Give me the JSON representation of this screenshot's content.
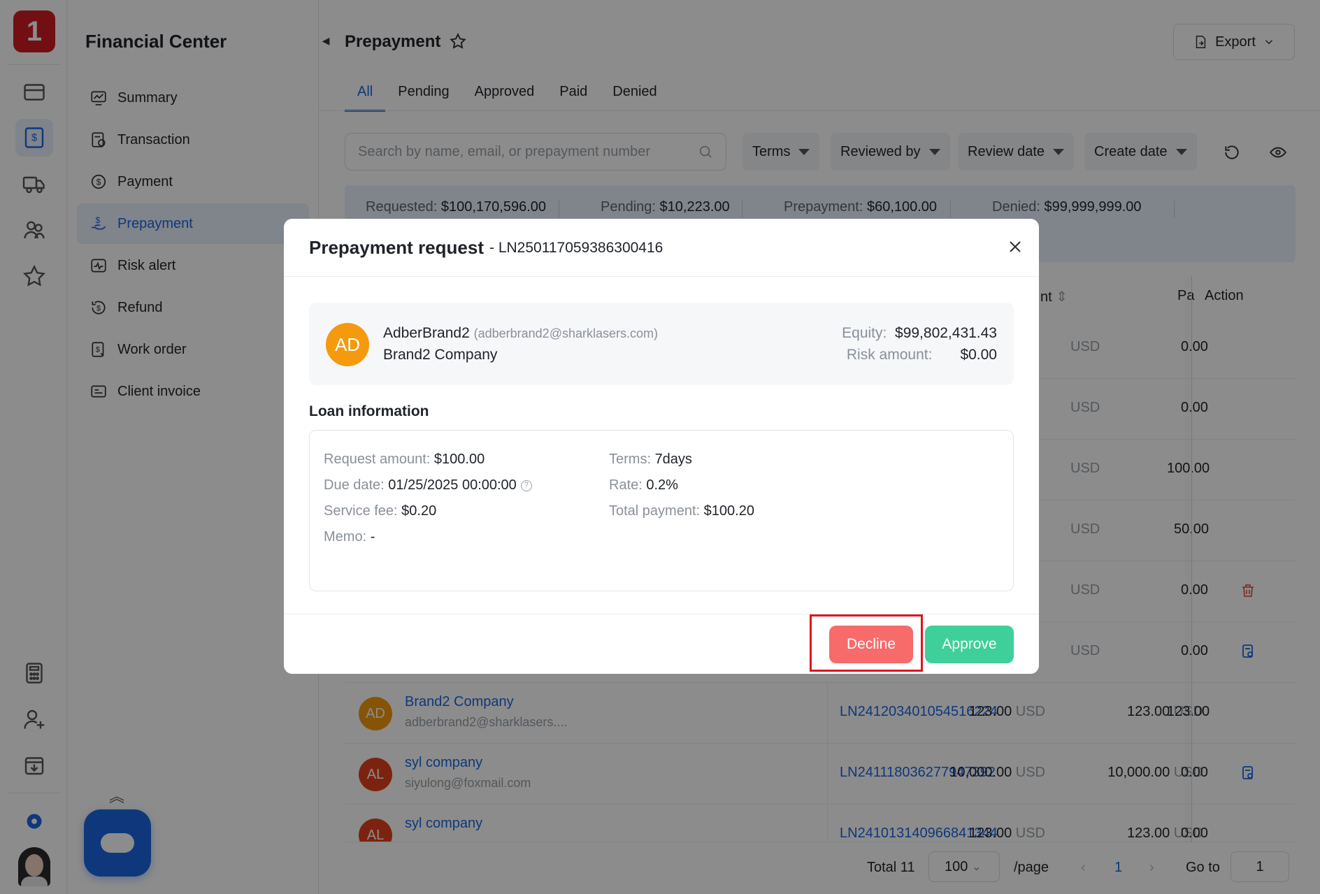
{
  "app": {
    "logo_text": "1"
  },
  "sidebar": {
    "title": "Financial Center",
    "items": [
      {
        "label": "Summary",
        "icon": "chart-icon"
      },
      {
        "label": "Transaction",
        "icon": "ledger-icon"
      },
      {
        "label": "Payment",
        "icon": "dollar-circle-icon"
      },
      {
        "label": "Prepayment",
        "icon": "hand-coin-icon",
        "active": true
      },
      {
        "label": "Risk alert",
        "icon": "pulse-icon"
      },
      {
        "label": "Refund",
        "icon": "refund-icon"
      },
      {
        "label": "Work order",
        "icon": "document-icon"
      },
      {
        "label": "Client invoice",
        "icon": "invoice-icon"
      }
    ]
  },
  "header": {
    "title": "Prepayment",
    "export_label": "Export"
  },
  "tabs": [
    "All",
    "Pending",
    "Approved",
    "Paid",
    "Denied"
  ],
  "search": {
    "placeholder": "Search by name, email, or prepayment number"
  },
  "filters": [
    "Terms",
    "Reviewed by",
    "Review date",
    "Create date"
  ],
  "summary": {
    "requested_label": "Requested:",
    "requested_value": "$100,170,596.00",
    "pending_label": "Pending:",
    "pending_value": "$10,223.00",
    "prepayment_label": "Prepayment:",
    "prepayment_value": "$60,100.00",
    "denied_label": "Denied:",
    "denied_value": "$99,999,999.00"
  },
  "table": {
    "headers": {
      "amount_partial": "nt",
      "paid_partial": "Pa",
      "action": "Action"
    },
    "rows": [
      {
        "c2": "USD",
        "c3": "0.00"
      },
      {
        "c2": "USD",
        "c3": "0.00"
      },
      {
        "c2": "USD",
        "c3": "100.00"
      },
      {
        "c2": "USD",
        "c3": "50.00"
      },
      {
        "c2": "USD",
        "c3": "0.00"
      },
      {
        "c2": "USD",
        "c3": "0.00"
      },
      {
        "avatar": "AD",
        "name": "Brand2 Company",
        "email": "adberbrand2@sharklasers....",
        "number": "LN241203401054516224",
        "requested": "123.00",
        "currency": "USD",
        "total": "123.00",
        "paid": "123.00"
      },
      {
        "avatar": "AL",
        "name": "syl company",
        "email": "siyulong@foxmail.com",
        "number": "LN241118036277947392",
        "requested": "10,000.00",
        "currency": "USD",
        "total": "10,000.00",
        "paid": "0.00"
      },
      {
        "avatar": "AL",
        "name": "syl company",
        "email": "",
        "number": "LN241013140966841344",
        "requested": "123.00",
        "currency": "USD",
        "total": "123.00",
        "paid": "0.00"
      }
    ]
  },
  "pagination": {
    "total": "Total 11",
    "page_size": "100",
    "per_page": "/page",
    "current": "1",
    "goto_label": "Go to",
    "goto_value": "1"
  },
  "modal": {
    "title": "Prepayment request",
    "number": "- LN250117059386300416",
    "client": {
      "avatar": "AD",
      "name": "AdberBrand2",
      "email": "(adberbrand2@sharklasers.com)",
      "company": "Brand2 Company",
      "equity_label": "Equity:",
      "equity_value": "$99,802,431.43",
      "risk_label": "Risk amount:",
      "risk_value": "$0.00"
    },
    "loan_title": "Loan information",
    "loan": {
      "request_amount_label": "Request amount:",
      "request_amount": "$100.00",
      "terms_label": "Terms:",
      "terms": "7days",
      "due_date_label": "Due date:",
      "due_date": "01/25/2025 00:00:00",
      "rate_label": "Rate:",
      "rate": "0.2%",
      "service_fee_label": "Service fee:",
      "service_fee": "$0.20",
      "total_payment_label": "Total payment:",
      "total_payment": "$100.20",
      "memo_label": "Memo:",
      "memo": "-"
    },
    "decline_label": "Decline",
    "approve_label": "Approve"
  },
  "colors": {
    "accent": "#1a66e0",
    "decline": "#f76b6b",
    "approve": "#3ecf9a",
    "highlight": "#e0141e"
  }
}
